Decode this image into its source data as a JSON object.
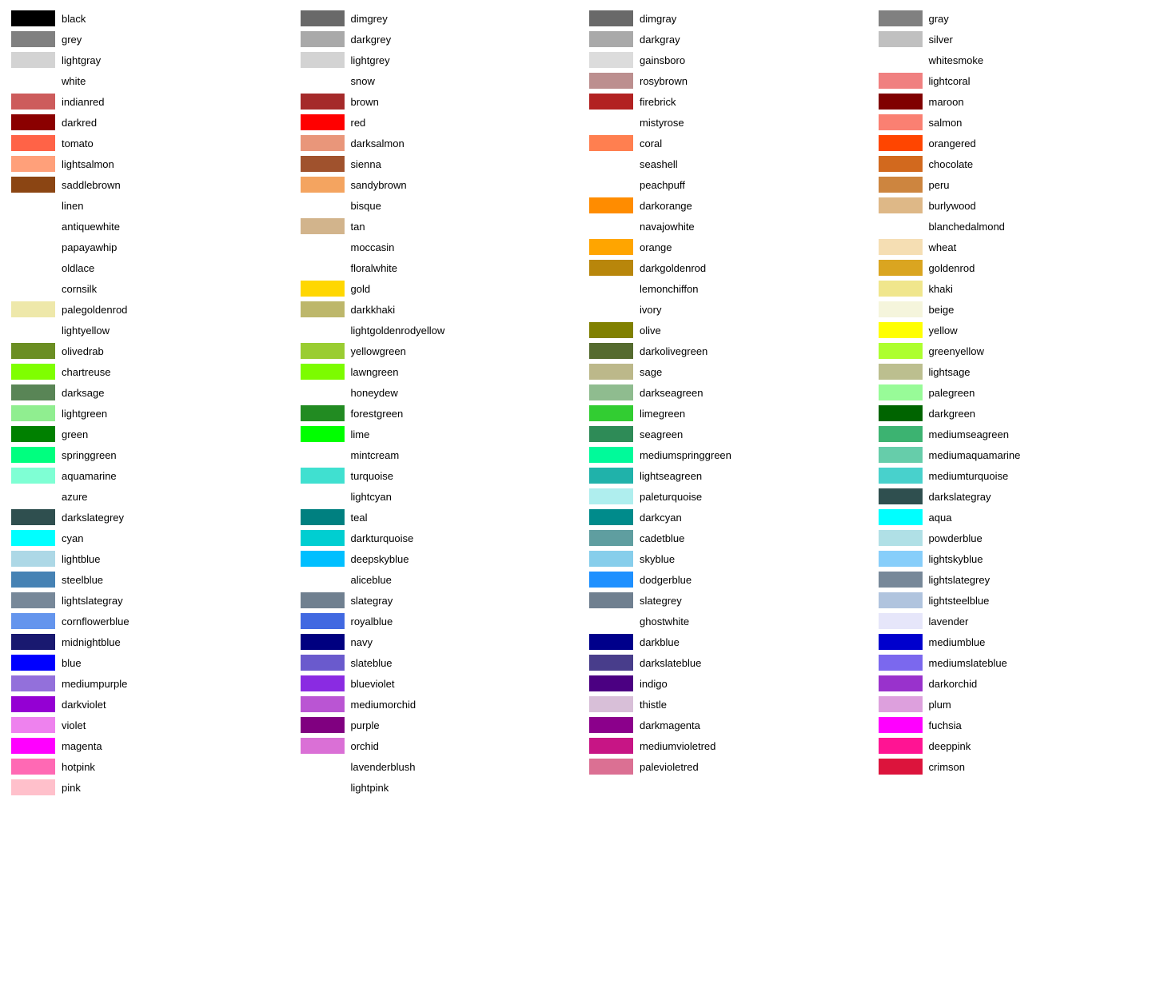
{
  "columns": [
    [
      {
        "name": "black",
        "color": "#000000"
      },
      {
        "name": "grey",
        "color": "#808080"
      },
      {
        "name": "lightgray",
        "color": "#d3d3d3"
      },
      {
        "name": "white",
        "color": null
      },
      {
        "name": "indianred",
        "color": "#cd5c5c"
      },
      {
        "name": "darkred",
        "color": "#8b0000"
      },
      {
        "name": "tomato",
        "color": "#ff6347"
      },
      {
        "name": "lightsalmon",
        "color": "#ffa07a"
      },
      {
        "name": "saddlebrown",
        "color": "#8b4513"
      },
      {
        "name": "linen",
        "color": null
      },
      {
        "name": "antiquewhite",
        "color": null
      },
      {
        "name": "papayawhip",
        "color": null
      },
      {
        "name": "oldlace",
        "color": null
      },
      {
        "name": "cornsilk",
        "color": null
      },
      {
        "name": "palegoldenrod",
        "color": "#eee8aa"
      },
      {
        "name": "lightyellow",
        "color": null
      },
      {
        "name": "olivedrab",
        "color": "#6b8e23"
      },
      {
        "name": "chartreuse",
        "color": "#7fff00"
      },
      {
        "name": "darksage",
        "color": "#598556"
      },
      {
        "name": "lightgreen",
        "color": "#90ee90"
      },
      {
        "name": "green",
        "color": "#008000"
      },
      {
        "name": "springgreen",
        "color": "#00ff7f"
      },
      {
        "name": "aquamarine",
        "color": "#7fffd4"
      },
      {
        "name": "azure",
        "color": null
      },
      {
        "name": "darkslategrey",
        "color": "#2f4f4f"
      },
      {
        "name": "cyan",
        "color": "#00ffff"
      },
      {
        "name": "lightblue",
        "color": "#add8e6"
      },
      {
        "name": "steelblue",
        "color": "#4682b4"
      },
      {
        "name": "lightslategray",
        "color": "#778899"
      },
      {
        "name": "cornflowerblue",
        "color": "#6495ed"
      },
      {
        "name": "midnightblue",
        "color": "#191970"
      },
      {
        "name": "blue",
        "color": "#0000ff"
      },
      {
        "name": "mediumpurple",
        "color": "#9370db"
      },
      {
        "name": "darkviolet",
        "color": "#9400d3"
      },
      {
        "name": "violet",
        "color": "#ee82ee"
      },
      {
        "name": "magenta",
        "color": "#ff00ff"
      },
      {
        "name": "hotpink",
        "color": "#ff69b4"
      },
      {
        "name": "pink",
        "color": "#ffc0cb"
      }
    ],
    [
      {
        "name": "dimgrey",
        "color": "#696969"
      },
      {
        "name": "darkgrey",
        "color": "#a9a9a9"
      },
      {
        "name": "lightgrey",
        "color": "#d3d3d3"
      },
      {
        "name": "snow",
        "color": null
      },
      {
        "name": "brown",
        "color": "#a52a2a"
      },
      {
        "name": "red",
        "color": "#ff0000"
      },
      {
        "name": "darksalmon",
        "color": "#e9967a"
      },
      {
        "name": "sienna",
        "color": "#a0522d"
      },
      {
        "name": "sandybrown",
        "color": "#f4a460"
      },
      {
        "name": "bisque",
        "color": null
      },
      {
        "name": "tan",
        "color": "#d2b48c"
      },
      {
        "name": "moccasin",
        "color": null
      },
      {
        "name": "floralwhite",
        "color": null
      },
      {
        "name": "gold",
        "color": "#ffd700"
      },
      {
        "name": "darkkhaki",
        "color": "#bdb76b"
      },
      {
        "name": "lightgoldenrodyellow",
        "color": null
      },
      {
        "name": "yellowgreen",
        "color": "#9acd32"
      },
      {
        "name": "lawngreen",
        "color": "#7cfc00"
      },
      {
        "name": "honeydew",
        "color": null
      },
      {
        "name": "forestgreen",
        "color": "#228b22"
      },
      {
        "name": "lime",
        "color": "#00ff00"
      },
      {
        "name": "mintcream",
        "color": null
      },
      {
        "name": "turquoise",
        "color": "#40e0d0"
      },
      {
        "name": "lightcyan",
        "color": null
      },
      {
        "name": "teal",
        "color": "#008080"
      },
      {
        "name": "darkturquoise",
        "color": "#00ced1"
      },
      {
        "name": "deepskyblue",
        "color": "#00bfff"
      },
      {
        "name": "aliceblue",
        "color": null
      },
      {
        "name": "slategray",
        "color": "#708090"
      },
      {
        "name": "royalblue",
        "color": "#4169e1"
      },
      {
        "name": "navy",
        "color": "#000080"
      },
      {
        "name": "slateblue",
        "color": "#6a5acd"
      },
      {
        "name": "blueviolet",
        "color": "#8a2be2"
      },
      {
        "name": "mediumorchid",
        "color": "#ba55d3"
      },
      {
        "name": "purple",
        "color": "#800080"
      },
      {
        "name": "orchid",
        "color": "#da70d6"
      },
      {
        "name": "lavenderblush",
        "color": null
      },
      {
        "name": "lightpink",
        "color": null
      }
    ],
    [
      {
        "name": "dimgray",
        "color": "#696969"
      },
      {
        "name": "darkgray",
        "color": "#a9a9a9"
      },
      {
        "name": "gainsboro",
        "color": "#dcdcdc"
      },
      {
        "name": "rosybrown",
        "color": "#bc8f8f"
      },
      {
        "name": "firebrick",
        "color": "#b22222"
      },
      {
        "name": "mistyrose",
        "color": null
      },
      {
        "name": "coral",
        "color": "#ff7f50"
      },
      {
        "name": "seashell",
        "color": null
      },
      {
        "name": "peachpuff",
        "color": null
      },
      {
        "name": "darkorange",
        "color": "#ff8c00"
      },
      {
        "name": "navajowhite",
        "color": null
      },
      {
        "name": "orange",
        "color": "#ffa500"
      },
      {
        "name": "darkgoldenrod",
        "color": "#b8860b"
      },
      {
        "name": "lemonchiffon",
        "color": null
      },
      {
        "name": "ivory",
        "color": null
      },
      {
        "name": "olive",
        "color": "#808000"
      },
      {
        "name": "darkolivegreen",
        "color": "#556b2f"
      },
      {
        "name": "sage",
        "color": "#bcb88a"
      },
      {
        "name": "darkseagreen",
        "color": "#8fbc8f"
      },
      {
        "name": "limegreen",
        "color": "#32cd32"
      },
      {
        "name": "seagreen",
        "color": "#2e8b57"
      },
      {
        "name": "mediumspringgreen",
        "color": "#00fa9a"
      },
      {
        "name": "lightseagreen",
        "color": "#20b2aa"
      },
      {
        "name": "paleturquoise",
        "color": "#afeeee"
      },
      {
        "name": "darkcyan",
        "color": "#008b8b"
      },
      {
        "name": "cadetblue",
        "color": "#5f9ea0"
      },
      {
        "name": "skyblue",
        "color": "#87ceeb"
      },
      {
        "name": "dodgerblue",
        "color": "#1e90ff"
      },
      {
        "name": "slategrey",
        "color": "#708090"
      },
      {
        "name": "ghostwhite",
        "color": null
      },
      {
        "name": "darkblue",
        "color": "#00008b"
      },
      {
        "name": "darkslateblue",
        "color": "#483d8b"
      },
      {
        "name": "indigo",
        "color": "#4b0082"
      },
      {
        "name": "thistle",
        "color": "#d8bfd8"
      },
      {
        "name": "darkmagenta",
        "color": "#8b008b"
      },
      {
        "name": "mediumvioletred",
        "color": "#c71585"
      },
      {
        "name": "palevioletred",
        "color": "#db7093"
      }
    ],
    [
      {
        "name": "gray",
        "color": "#808080"
      },
      {
        "name": "silver",
        "color": "#c0c0c0"
      },
      {
        "name": "whitesmoke",
        "color": null
      },
      {
        "name": "lightcoral",
        "color": "#f08080"
      },
      {
        "name": "maroon",
        "color": "#800000"
      },
      {
        "name": "salmon",
        "color": "#fa8072"
      },
      {
        "name": "orangered",
        "color": "#ff4500"
      },
      {
        "name": "chocolate",
        "color": "#d2691e"
      },
      {
        "name": "peru",
        "color": "#cd853f"
      },
      {
        "name": "burlywood",
        "color": "#deb887"
      },
      {
        "name": "blanchedalmond",
        "color": null
      },
      {
        "name": "wheat",
        "color": "#f5deb3"
      },
      {
        "name": "goldenrod",
        "color": "#daa520"
      },
      {
        "name": "khaki",
        "color": "#f0e68c"
      },
      {
        "name": "beige",
        "color": "#f5f5dc"
      },
      {
        "name": "yellow",
        "color": "#ffff00"
      },
      {
        "name": "greenyellow",
        "color": "#adff2f"
      },
      {
        "name": "lightsage",
        "color": "#bcbf8f"
      },
      {
        "name": "palegreen",
        "color": "#98fb98"
      },
      {
        "name": "darkgreen",
        "color": "#006400"
      },
      {
        "name": "mediumseagreen",
        "color": "#3cb371"
      },
      {
        "name": "mediumaquamarine",
        "color": "#66cdaa"
      },
      {
        "name": "mediumturquoise",
        "color": "#48d1cc"
      },
      {
        "name": "darkslategray",
        "color": "#2f4f4f"
      },
      {
        "name": "aqua",
        "color": "#00ffff"
      },
      {
        "name": "powderblue",
        "color": "#b0e0e6"
      },
      {
        "name": "lightskyblue",
        "color": "#87cefa"
      },
      {
        "name": "lightslategrey",
        "color": "#778899"
      },
      {
        "name": "lightsteelblue",
        "color": "#b0c4de"
      },
      {
        "name": "lavender",
        "color": "#e6e6fa"
      },
      {
        "name": "mediumblue",
        "color": "#0000cd"
      },
      {
        "name": "mediumslateblue",
        "color": "#7b68ee"
      },
      {
        "name": "darkorchid",
        "color": "#9932cc"
      },
      {
        "name": "plum",
        "color": "#dda0dd"
      },
      {
        "name": "fuchsia",
        "color": "#ff00ff"
      },
      {
        "name": "deeppink",
        "color": "#ff1493"
      },
      {
        "name": "crimson",
        "color": "#dc143c"
      }
    ]
  ]
}
